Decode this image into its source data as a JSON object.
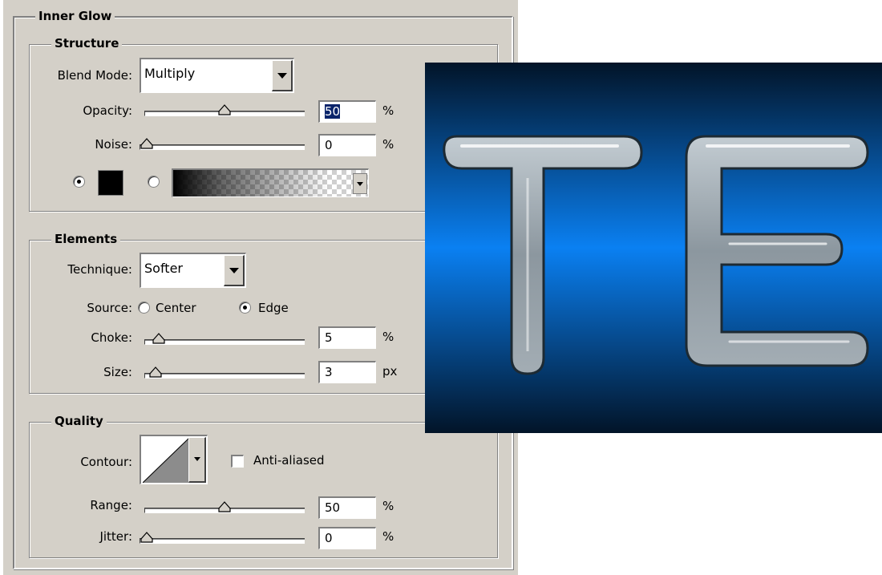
{
  "inner_glow": {
    "title": "Inner Glow",
    "structure": {
      "title": "Structure",
      "blend_mode_label": "Blend Mode:",
      "blend_mode_value": "Multiply",
      "opacity_label": "Opacity:",
      "opacity_value": "50",
      "opacity_unit": "%",
      "opacity_fraction": 0.5,
      "noise_label": "Noise:",
      "noise_value": "0",
      "noise_unit": "%",
      "noise_fraction": 0.0,
      "color_option_selected": "solid",
      "swatch_color": "#000000"
    },
    "elements": {
      "title": "Elements",
      "technique_label": "Technique:",
      "technique_value": "Softer",
      "source_label": "Source:",
      "source_center": "Center",
      "source_edge": "Edge",
      "source_selected": "edge",
      "choke_label": "Choke:",
      "choke_value": "5",
      "choke_unit": "%",
      "choke_fraction": 0.05,
      "size_label": "Size:",
      "size_value": "3",
      "size_unit": "px",
      "size_fraction": 0.03
    },
    "quality": {
      "title": "Quality",
      "contour_label": "Contour:",
      "anti_aliased_label": "Anti-aliased",
      "anti_aliased_checked": false,
      "range_label": "Range:",
      "range_value": "50",
      "range_unit": "%",
      "range_fraction": 0.5,
      "jitter_label": "Jitter:",
      "jitter_value": "0",
      "jitter_unit": "%",
      "jitter_fraction": 0.0
    }
  },
  "preview": {
    "text": "TE",
    "bg_top": "#021a33",
    "bg_mid": "#0a7ff0",
    "bg_bottom": "#021a33",
    "letter_color": "#9aa4ab"
  }
}
